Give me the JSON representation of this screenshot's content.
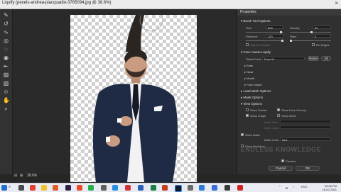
{
  "window": {
    "title": "Liquify (pexels-andrea-piacquadio-3785094.jpg @ 38.6%)",
    "close_glyph": "×"
  },
  "canvas": {
    "zoom": "38.6%"
  },
  "panel": {
    "header": "Properties",
    "brush_tool_options": {
      "title": "Brush Tool Options",
      "size_label": "Size:",
      "size_value": "800",
      "density_label": "Density:",
      "density_value": "50",
      "pressure_label": "Pressure:",
      "pressure_value": "100",
      "rate_label": "Rate:",
      "rate_value": "0",
      "stylus_label": "Stylus Pressure",
      "pin_edges_label": "Pin Edges"
    },
    "face_aware": {
      "title": "Face-Aware Liquify",
      "select_face_label": "Select Face:",
      "select_face_value": "Face #1",
      "reset_label": "Reset",
      "all_label": "All",
      "items": [
        "Eyes",
        "Nose",
        "Mouth",
        "Face Shape"
      ]
    },
    "load_mesh": {
      "title": "Load Mesh Options"
    },
    "mask_options": {
      "title": "Mask Options"
    },
    "view_options": {
      "title": "View Options",
      "show_guides": "Show Guides",
      "show_face_overlay": "Show Face Overlay",
      "show_image": "Show Image",
      "show_mesh": "Show Mesh",
      "mesh_size": "Mesh Size:",
      "mesh_color": "Mesh Color:"
    },
    "show_mask": "Show Mask",
    "mask_color_label": "Mask Color:",
    "mask_color_value": "Red",
    "show_backdrop": "Show Backdrop",
    "preview": "Preview",
    "cancel": "Cancel",
    "ok": "OK"
  },
  "watermark": "ENDLESS KNOWLEDGE",
  "taskbar": {
    "search_glyph": "⌕",
    "lang": "ENG",
    "time": "05:28 PM",
    "date": "16-02-2021"
  },
  "colors": {
    "canvas_checker": "#cfcfcf",
    "suit": "#1f2b45",
    "accent": "#3f86d6"
  }
}
